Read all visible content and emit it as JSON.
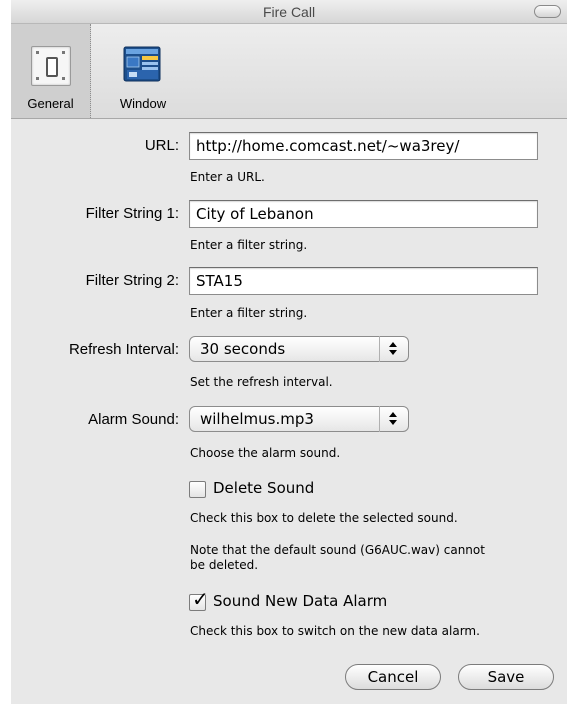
{
  "window": {
    "title": "Fire Call"
  },
  "toolbar": {
    "items": [
      {
        "label": "General",
        "icon": "switch-icon",
        "selected": true
      },
      {
        "label": "Window",
        "icon": "window-icon",
        "selected": false
      }
    ]
  },
  "form": {
    "url": {
      "label": "URL:",
      "value": "http://home.comcast.net/~wa3rey/",
      "hint": "Enter a URL."
    },
    "filter1": {
      "label": "Filter String 1:",
      "value": "City of Lebanon",
      "hint": "Enter a filter string."
    },
    "filter2": {
      "label": "Filter String 2:",
      "value": "STA15",
      "hint": "Enter a filter string."
    },
    "refresh": {
      "label": "Refresh Interval:",
      "value": "30 seconds",
      "hint": "Set the refresh interval."
    },
    "alarm": {
      "label": "Alarm Sound:",
      "value": "wilhelmus.mp3",
      "hint": "Choose the alarm sound."
    },
    "delete_sound": {
      "label": "Delete Sound",
      "checked": false,
      "hint": "Check this box to delete the selected sound.",
      "note_line1": "Note that the default sound (G6AUC.wav) cannot",
      "note_line2": "be deleted."
    },
    "new_data_alarm": {
      "label": "Sound New Data Alarm",
      "checked": true,
      "checkmark": "✓",
      "hint": "Check this box to switch on the new data alarm."
    }
  },
  "buttons": {
    "cancel": "Cancel",
    "save": "Save"
  }
}
